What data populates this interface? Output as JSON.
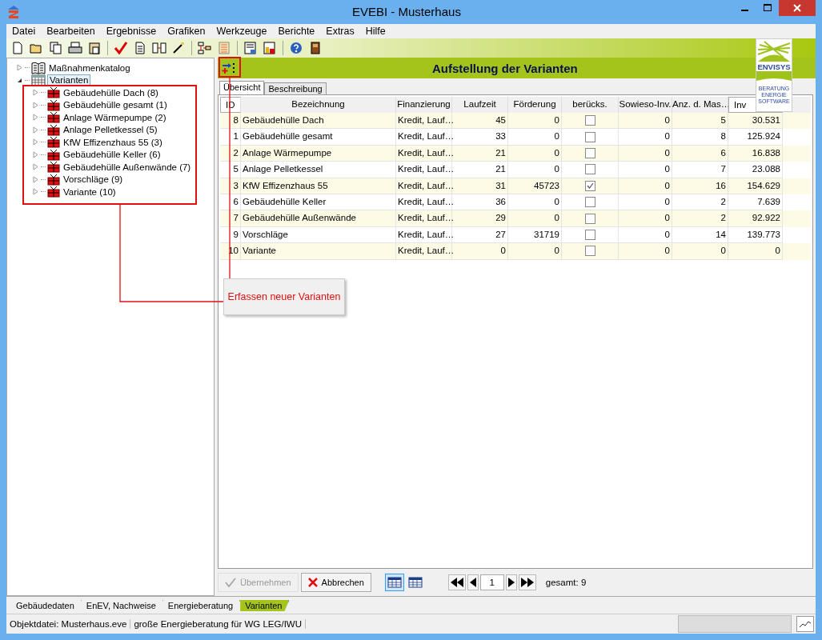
{
  "window": {
    "title": "EVEBI - Musterhaus"
  },
  "menu": [
    "Datei",
    "Bearbeiten",
    "Ergebnisse",
    "Grafiken",
    "Werkzeuge",
    "Berichte",
    "Extras",
    "Hilfe"
  ],
  "tree": [
    {
      "label": "Maßnahmenkatalog",
      "kind": "catalog",
      "expanded": false,
      "selected": false
    },
    {
      "label": "Varianten",
      "kind": "variants",
      "expanded": true,
      "selected": true,
      "children": [
        {
          "label": "Gebäudehülle Dach (8)",
          "expanded": false
        },
        {
          "label": "Gebäudehülle gesamt (1)",
          "expanded": false
        },
        {
          "label": "Anlage Wärmepumpe (2)",
          "expanded": false
        },
        {
          "label": "Anlage Pelletkessel (5)",
          "expanded": false
        },
        {
          "label": "KfW Effizenzhaus 55 (3)",
          "expanded": false
        },
        {
          "label": "Gebäudehülle Keller (6)",
          "expanded": false
        },
        {
          "label": "Gebäudehülle Außenwände (7)",
          "expanded": false
        },
        {
          "label": "Vorschläge (9)",
          "expanded": false
        },
        {
          "label": "Variante (10)",
          "expanded": false
        }
      ]
    }
  ],
  "panel": {
    "title": "Aufstellung der Varianten"
  },
  "logo": {
    "name": "ENVISYS",
    "lines": [
      "BERATUNG",
      "ENERGIE",
      "SOFTWARE"
    ]
  },
  "tabs": [
    {
      "label": "Übersicht",
      "selected": true
    },
    {
      "label": "Beschreibung",
      "selected": false
    }
  ],
  "table": {
    "columns": [
      "ID",
      "Bezeichnung",
      "Finanzierung",
      "Laufzeit",
      "Förderung",
      "berücks.",
      "Sowieso-Inv.",
      "Anz. d. Mas…",
      "Inv"
    ],
    "rows": [
      {
        "id": "8",
        "name": "Gebäudehülle Dach",
        "fin": "Kredit, Lauf…",
        "laufzeit": "45",
        "foerderung": "0",
        "checked": false,
        "sowieso": "0",
        "anz": "5",
        "inv": "30.531"
      },
      {
        "id": "1",
        "name": "Gebäudehülle gesamt",
        "fin": "Kredit, Lauf…",
        "laufzeit": "33",
        "foerderung": "0",
        "checked": false,
        "sowieso": "0",
        "anz": "8",
        "inv": "125.924"
      },
      {
        "id": "2",
        "name": "Anlage Wärmepumpe",
        "fin": "Kredit, Lauf…",
        "laufzeit": "21",
        "foerderung": "0",
        "checked": false,
        "sowieso": "0",
        "anz": "6",
        "inv": "16.838"
      },
      {
        "id": "5",
        "name": "Anlage Pelletkessel",
        "fin": "Kredit, Lauf…",
        "laufzeit": "21",
        "foerderung": "0",
        "checked": false,
        "sowieso": "0",
        "anz": "7",
        "inv": "23.088"
      },
      {
        "id": "3",
        "name": "KfW Effizenzhaus 55",
        "fin": "Kredit, Lauf…",
        "laufzeit": "31",
        "foerderung": "45723",
        "checked": true,
        "sowieso": "0",
        "anz": "16",
        "inv": "154.629"
      },
      {
        "id": "6",
        "name": "Gebäudehülle Keller",
        "fin": "Kredit, Lauf…",
        "laufzeit": "36",
        "foerderung": "0",
        "checked": false,
        "sowieso": "0",
        "anz": "2",
        "inv": "7.639"
      },
      {
        "id": "7",
        "name": "Gebäudehülle Außenwände",
        "fin": "Kredit, Lauf…",
        "laufzeit": "29",
        "foerderung": "0",
        "checked": false,
        "sowieso": "0",
        "anz": "2",
        "inv": "92.922"
      },
      {
        "id": "9",
        "name": "Vorschläge",
        "fin": "Kredit, Lauf…",
        "laufzeit": "27",
        "foerderung": "31719",
        "checked": false,
        "sowieso": "0",
        "anz": "14",
        "inv": "139.773"
      },
      {
        "id": "10",
        "name": "Variante",
        "fin": "Kredit, Lauf…",
        "laufzeit": "0",
        "foerderung": "0",
        "checked": false,
        "sowieso": "0",
        "anz": "0",
        "inv": "0"
      }
    ]
  },
  "actions": [
    {
      "label": "Übernehmen",
      "kind": "apply",
      "disabled": true
    },
    {
      "label": "Abbrechen",
      "kind": "cancel",
      "disabled": false
    }
  ],
  "views": [
    {
      "selected": true
    },
    {
      "selected": false
    }
  ],
  "pager": {
    "page": "1",
    "total": "gesamt: 9"
  },
  "bottom_tabs": [
    {
      "label": "Gebäudedaten",
      "selected": false
    },
    {
      "label": "EnEV, Nachweise",
      "selected": false
    },
    {
      "label": "Energieberatung",
      "selected": false
    },
    {
      "label": "Varianten",
      "selected": true
    }
  ],
  "status_bar": [
    "Objektdatei: Musterhaus.eve",
    "große Energieberatung für WG LEG/IWU"
  ],
  "annotation": {
    "callout": "Erfassen neuer Varianten"
  }
}
